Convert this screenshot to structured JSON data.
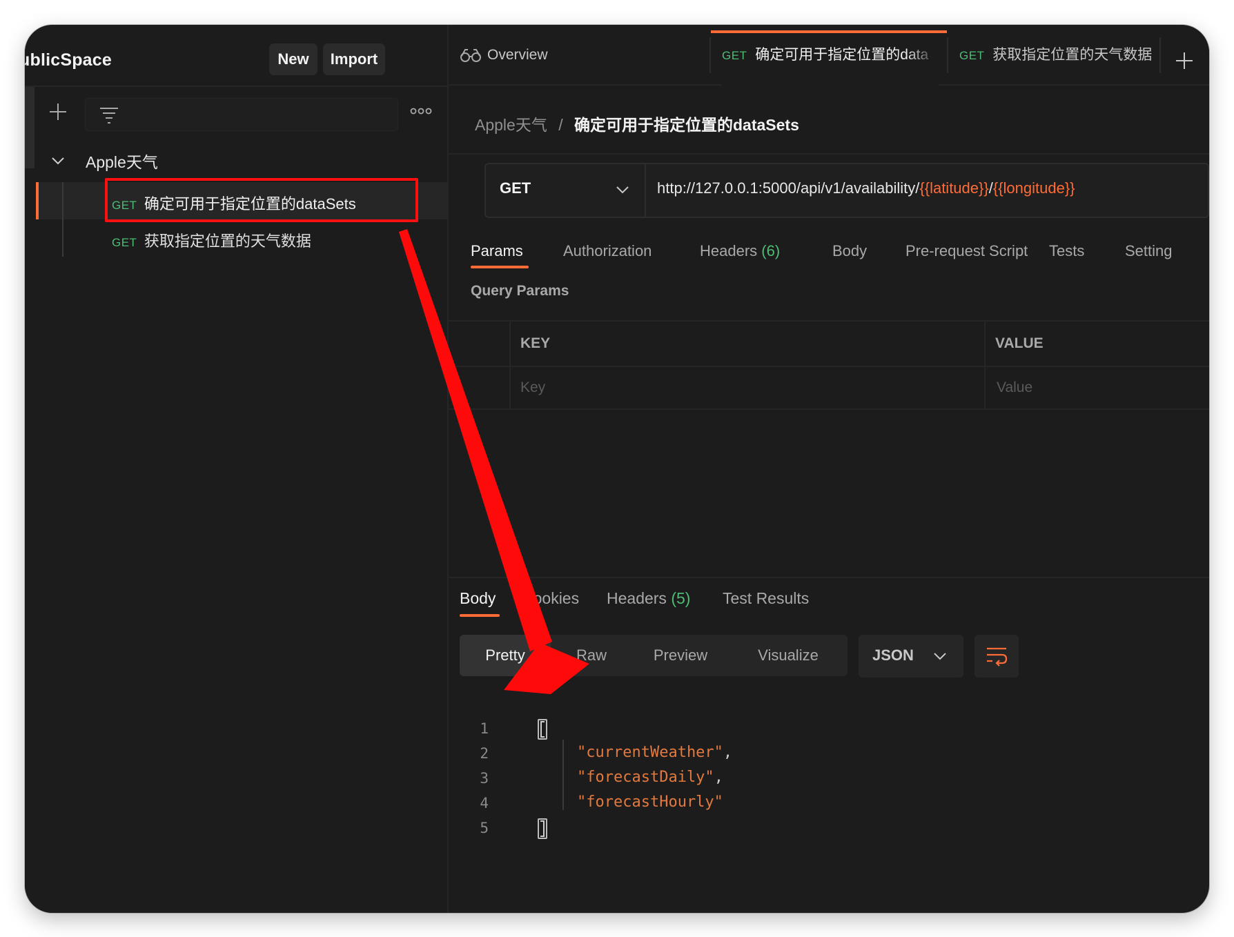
{
  "workspace": {
    "title": "ublicSpace",
    "new_label": "New",
    "import_label": "Import"
  },
  "sidebar": {
    "collection": {
      "name": "Apple天气"
    },
    "requests": [
      {
        "method": "GET",
        "name": "确定可用于指定位置的dataSets"
      },
      {
        "method": "GET",
        "name": "获取指定位置的天气数据"
      }
    ]
  },
  "tabs": {
    "overview": "Overview",
    "items": [
      {
        "method": "GET",
        "name": "确定可用于指定位置的data"
      },
      {
        "method": "GET",
        "name": "获取指定位置的天气数据"
      }
    ]
  },
  "breadcrumb": {
    "parent": "Apple天气",
    "separator": "/",
    "current": "确定可用于指定位置的dataSets"
  },
  "request": {
    "method": "GET",
    "url_base": "http://127.0.0.1:5000/api/v1/availability/",
    "url_var1": "{{latitude}}",
    "url_slash": "/",
    "url_var2": "{{longitude}}"
  },
  "request_tabs": {
    "params": "Params",
    "authorization": "Authorization",
    "headers": "Headers",
    "headers_count": "(6)",
    "body": "Body",
    "prerequest": "Pre-request Script",
    "tests": "Tests",
    "settings": "Setting"
  },
  "query_params": {
    "title": "Query Params",
    "key_header": "KEY",
    "value_header": "VALUE",
    "key_placeholder": "Key",
    "value_placeholder": "Value"
  },
  "response_tabs": {
    "body": "Body",
    "cookies": "Cookies",
    "headers": "Headers",
    "headers_count": "(5)",
    "test_results": "Test Results"
  },
  "response_view": {
    "pretty": "Pretty",
    "raw": "Raw",
    "preview": "Preview",
    "visualize": "Visualize",
    "format": "JSON"
  },
  "response_body": {
    "line_numbers": [
      "1",
      "2",
      "3",
      "4",
      "5"
    ],
    "values": [
      "\"currentWeather\"",
      "\"forecastDaily\"",
      "\"forecastHourly\""
    ]
  },
  "colors": {
    "accent": "#ff6c37",
    "get_method": "#4dbd74",
    "annotation": "#ff1010"
  }
}
